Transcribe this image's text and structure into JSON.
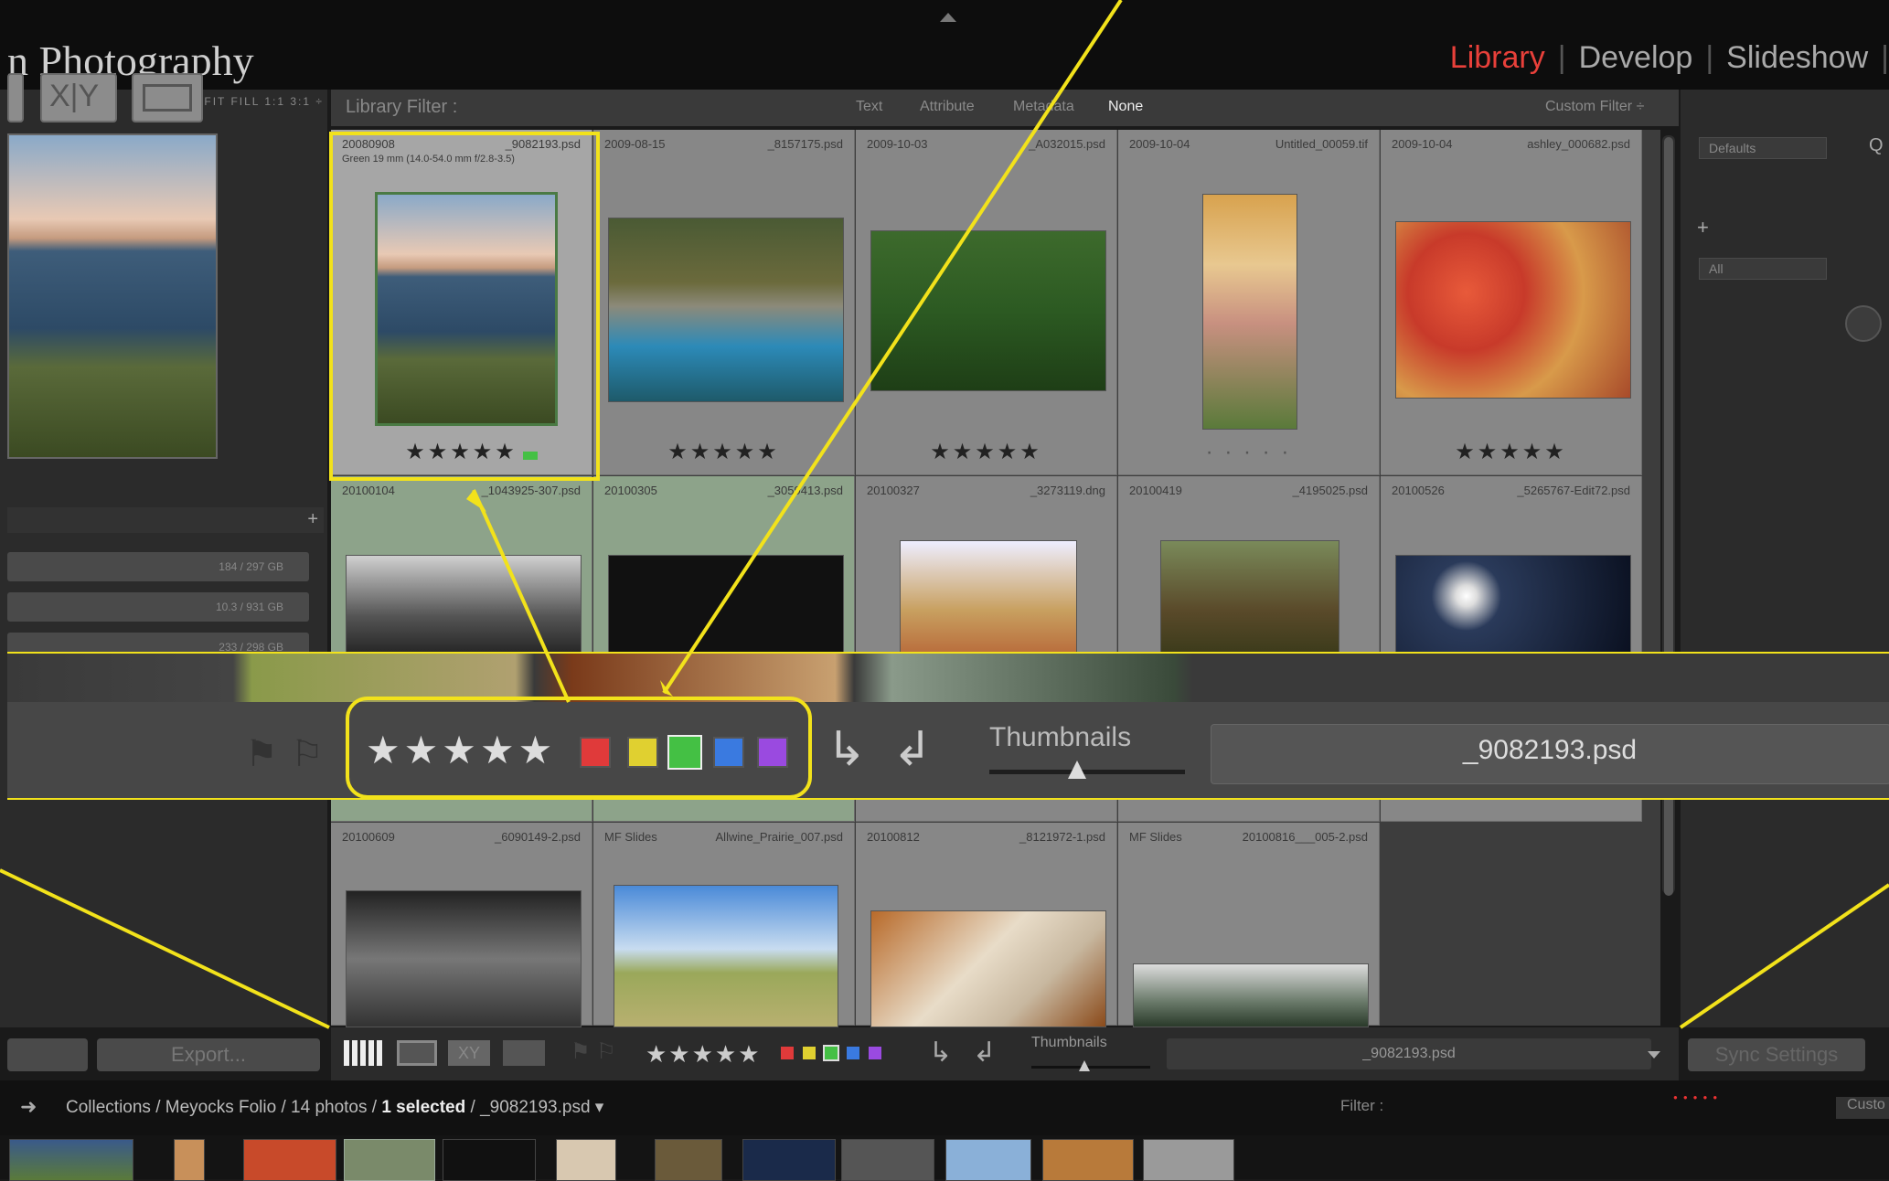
{
  "brand": "n Photography",
  "modules": {
    "library": "Library",
    "develop": "Develop",
    "slideshow": "Slideshow"
  },
  "navigator": {
    "zoom_options": "FIT  FILL  1:1  3:1 ÷"
  },
  "volumes": [
    {
      "label": "184 / 297 GB"
    },
    {
      "label": "10.3 / 931 GB"
    },
    {
      "label": "233 / 298 GB"
    }
  ],
  "library_filter": {
    "label": "Library Filter :",
    "tabs": [
      "Text",
      "Attribute",
      "Metadata",
      "None"
    ],
    "active_tab": "None",
    "custom": "Custom Filter ÷"
  },
  "right_panel": {
    "preset": "Defaults",
    "preset_q": "Q",
    "all_label": "All",
    "plus": "+"
  },
  "grid": {
    "row1": [
      {
        "date": "20080908",
        "file": "_9082193.psd",
        "sub": "Green   19 mm (14.0-54.0 mm f/2.8-3.5)",
        "stars": "★★★★★"
      },
      {
        "date": "2009-08-15",
        "file": "_8157175.psd",
        "sub": "",
        "stars": "★★★★★"
      },
      {
        "date": "2009-10-03",
        "file": "_A032015.psd",
        "sub": "",
        "stars": "★★★★★"
      },
      {
        "date": "2009-10-04",
        "file": "Untitled_00059.tif",
        "sub": "",
        "stars": "· · · · ·"
      },
      {
        "date": "2009-10-04",
        "file": "ashley_000682.psd",
        "sub": "",
        "stars": "★★★★★"
      }
    ],
    "row2": [
      {
        "date": "20100104",
        "file": "_1043925-307.psd",
        "sub": ""
      },
      {
        "date": "20100305",
        "file": "_3059413.psd",
        "sub": ""
      },
      {
        "date": "20100327",
        "file": "_3273119.dng",
        "sub": ""
      },
      {
        "date": "20100419",
        "file": "_4195025.psd",
        "sub": ""
      },
      {
        "date": "20100526",
        "file": "_5265767-Edit72.psd",
        "sub": ""
      }
    ],
    "row3": [
      {
        "date": "20100609",
        "file": "_6090149-2.psd",
        "sub": ""
      },
      {
        "date": "MF Slides",
        "file": "Allwine_Prairie_007.psd",
        "sub": ""
      },
      {
        "date": "20100812",
        "file": "_8121972-1.psd",
        "sub": ""
      },
      {
        "date": "MF Slides",
        "file": "20100816___005-2.psd",
        "sub": ""
      }
    ]
  },
  "zoomed_toolbar": {
    "stars": "★★★★★",
    "thumbnails_label": "Thumbnails",
    "filename": "_9082193.psd",
    "thumbnail_value": 0.4,
    "swatches": [
      "#e03a3a",
      "#e0d030",
      "#44c044",
      "#3a7ae0",
      "#9a4ae0"
    ]
  },
  "bottom_toolbar": {
    "export": "Export...",
    "stars": "★★★★★",
    "thumbnails_label": "Thumbnails",
    "filename": "_9082193.psd",
    "sync": "Sync Settings"
  },
  "breadcrumb": {
    "prefix": "Collections / Meyocks Folio / 14 photos / ",
    "selected": "1 selected",
    "suffix": " / _9082193.psd ▾"
  },
  "filmstrip_filter": {
    "label": "Filter :",
    "custom": "Custo"
  },
  "annotation_color": "#f2e21b"
}
